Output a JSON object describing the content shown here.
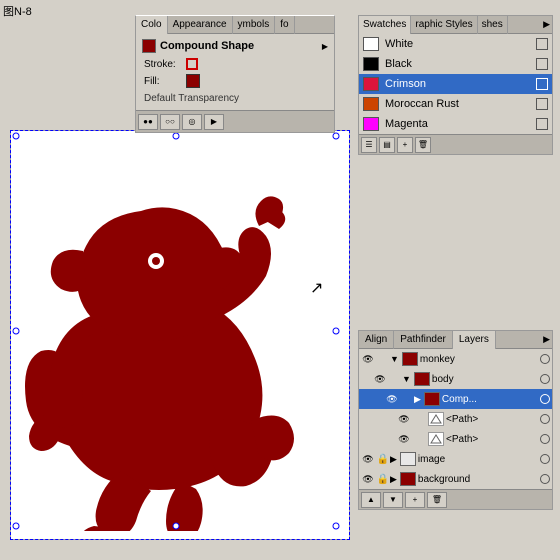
{
  "fig_label": "图N-8",
  "canvas": {
    "background": "#ffffff"
  },
  "appearance_panel": {
    "tabs": [
      "Colo",
      "Appearance",
      "ymbols",
      "fo"
    ],
    "active_tab": "Appearance",
    "compound_shape_label": "Compound Shape",
    "stroke_label": "Stroke:",
    "fill_label": "Fill:",
    "default_transparency": "Default Transparency",
    "toolbar_buttons": [
      "●●",
      "○○",
      "◎◎",
      "▶"
    ]
  },
  "swatches_panel": {
    "tabs": [
      "Swatches",
      "raphic Styles",
      "shes"
    ],
    "active_tab": "Swatches",
    "items": [
      {
        "name": "White",
        "color": "#ffffff",
        "selected": false
      },
      {
        "name": "Black",
        "color": "#000000",
        "selected": false
      },
      {
        "name": "Crimson",
        "color": "#dc143c",
        "selected": true
      },
      {
        "name": "Moroccan Rust",
        "color": "#cc4400",
        "selected": false
      },
      {
        "name": "Magenta",
        "color": "#ff00ff",
        "selected": false
      }
    ]
  },
  "layers_panel": {
    "tabs": [
      "Align",
      "Pathfinder",
      "Layers"
    ],
    "active_tab": "Layers",
    "items": [
      {
        "name": "monkey",
        "level": 0,
        "expanded": true,
        "has_thumb": true,
        "thumb_color": "#8b0000",
        "selected": false
      },
      {
        "name": "body",
        "level": 1,
        "expanded": true,
        "has_thumb": true,
        "thumb_color": "#8b0000",
        "selected": false
      },
      {
        "name": "Comp...",
        "level": 2,
        "expanded": false,
        "has_thumb": true,
        "thumb_color": "#8b0000",
        "selected": true
      },
      {
        "name": "<Path>",
        "level": 3,
        "expanded": false,
        "has_thumb": false,
        "selected": false
      },
      {
        "name": "<Path>",
        "level": 3,
        "expanded": false,
        "has_thumb": false,
        "selected": false
      },
      {
        "name": "image",
        "level": 0,
        "expanded": false,
        "has_thumb": false,
        "selected": false
      },
      {
        "name": "background",
        "level": 0,
        "expanded": false,
        "has_thumb": true,
        "thumb_color": "#8b0000",
        "selected": false
      }
    ],
    "bottom_buttons": [
      "▲",
      "▲",
      "🗐",
      "🗑"
    ]
  },
  "cursor": "↗"
}
